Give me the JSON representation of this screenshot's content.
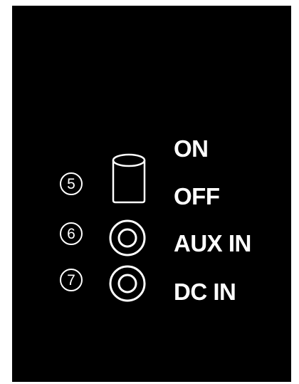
{
  "colors": {
    "background": "#000000",
    "foreground": "#ffffff"
  },
  "callouts": [
    {
      "number": "5",
      "icon": "rocker-switch-icon"
    },
    {
      "number": "6",
      "icon": "aux-jack-icon"
    },
    {
      "number": "7",
      "icon": "dc-jack-icon"
    }
  ],
  "labels": {
    "on": "ON",
    "off": "OFF",
    "aux_in": "AUX IN",
    "dc_in": "DC IN"
  }
}
